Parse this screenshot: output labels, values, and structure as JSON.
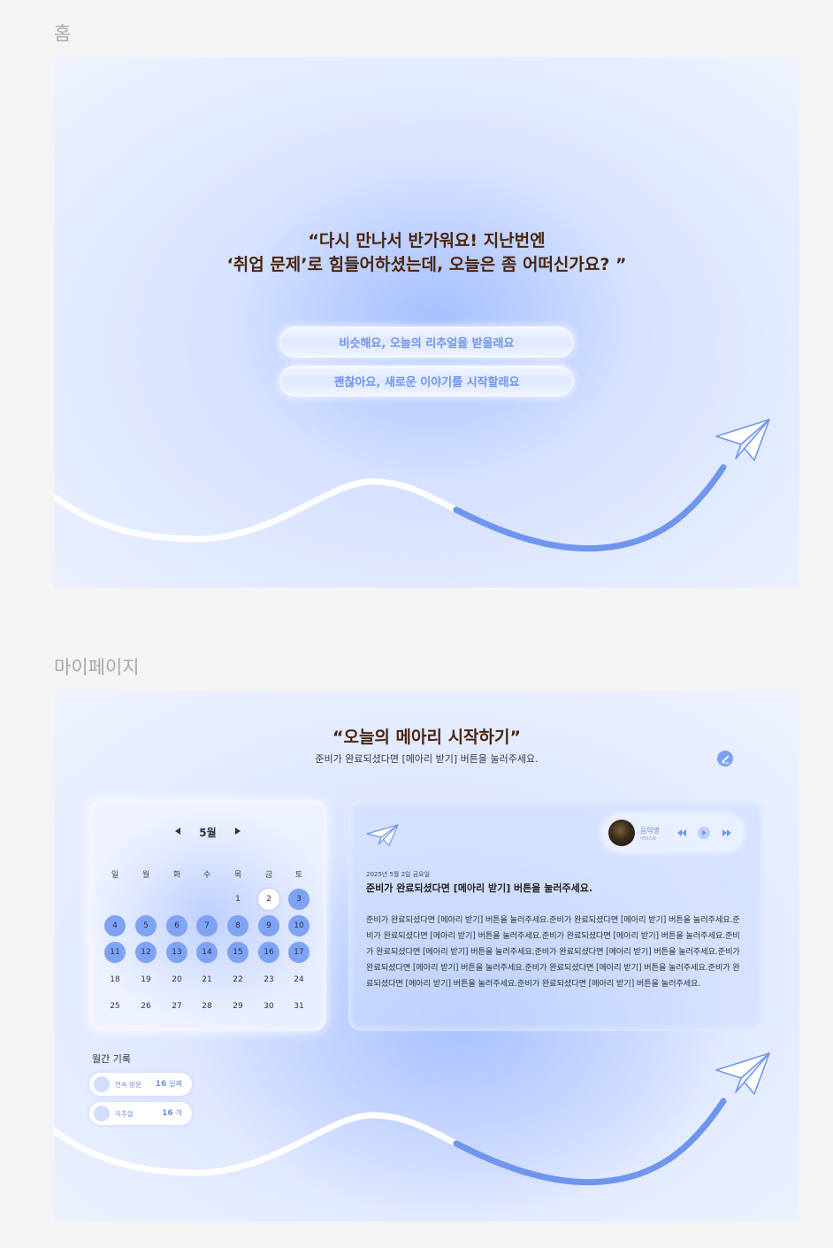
{
  "sections": {
    "home_label": "홈",
    "mypage_label": "마이페이지"
  },
  "home": {
    "question_line1": "“다시 만나서 반가워요! 지난번엔",
    "question_line2": "‘취업 문제’로 힘들어하셨는데, 오늘은 좀 어떠신가요? ”",
    "option_recall": "비슷해요, 오늘의 리추얼을 받을래요",
    "option_new": "괜찮아요, 새로운 이야기를 시작할래요"
  },
  "mypage": {
    "title": "“오늘의 메아리 시작하기”",
    "subtitle": "준비가 완료되셨다면 [메아리 받기] 버튼을 눌러주세요.",
    "calendar": {
      "month": "5월",
      "weekdays": [
        "일",
        "월",
        "화",
        "수",
        "목",
        "금",
        "토"
      ],
      "weeks": [
        [
          "",
          "",
          "",
          "",
          "1",
          "2",
          "3"
        ],
        [
          "4",
          "5",
          "6",
          "7",
          "8",
          "9",
          "10"
        ],
        [
          "11",
          "12",
          "13",
          "14",
          "15",
          "16",
          "17"
        ],
        [
          "18",
          "19",
          "20",
          "21",
          "22",
          "23",
          "24"
        ],
        [
          "25",
          "26",
          "27",
          "28",
          "29",
          "30",
          "31"
        ]
      ],
      "highlighted_days": [
        "3",
        "4",
        "5",
        "6",
        "7",
        "8",
        "9",
        "10",
        "11",
        "12",
        "13",
        "14",
        "15",
        "16",
        "17"
      ],
      "today": "2"
    },
    "memory": {
      "date": "2025년 5월 2일 금요일",
      "headline": "준비가 완료되셨다면 [메아리 받기] 버튼을 눌러주세요.",
      "body": "준비가 완료되셨다면 [메아리 받기] 버튼을 눌러주세요.준비가 완료되셨다면 [메아리 받기] 버튼을 눌러주세요.준비가 완료되셨다면 [메아리 받기] 버튼을 눌러주세요.준비가 완료되셨다면 [메아리 받기] 버튼을 눌러주세요.준비가 완료되셨다면 [메아리 받기] 버튼을 눌러주세요.준비가 완료되셨다면 [메아리 받기] 버튼을 눌러주세요.준비가 완료되셨다면 [메아리 받기] 버튼을 눌러주세요.준비가 완료되셨다면 [메아리 받기] 버튼을 눌러주세요.준비가 완료되셨다면 [메아리 받기] 버튼을 눌러주세요.준비가 완료되셨다면 [메아리 받기] 버튼을 눌러주세요.",
      "music": {
        "song": "음악명",
        "artist": "아티스트"
      }
    },
    "monthly": {
      "title": "월간 기록",
      "stats": [
        {
          "label": "연속 방문",
          "value": "16",
          "unit": "일째"
        },
        {
          "label": "리추얼",
          "value": "16",
          "unit": "개"
        }
      ]
    }
  },
  "colors": {
    "accent": "#7ea3f3",
    "wave_blue": "#6f95ee",
    "title_brown": "#4a2410"
  },
  "icons": [
    "paper-plane-icon",
    "edit-icon",
    "prev-icon",
    "play-icon",
    "next-icon",
    "chevron-left-icon",
    "chevron-right-icon"
  ]
}
